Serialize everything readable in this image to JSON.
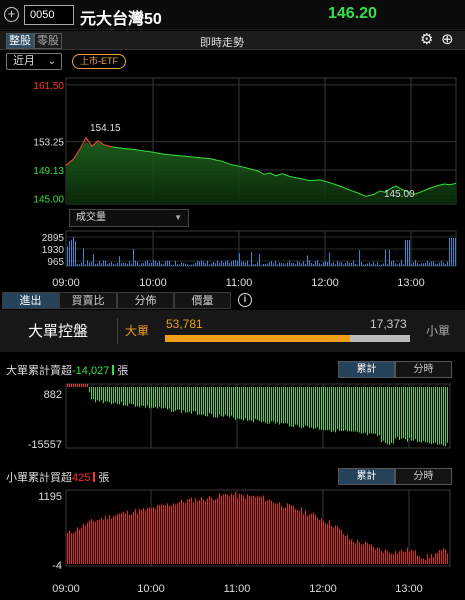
{
  "header": {
    "stock_code": "0050",
    "stock_name": "元大台灣50",
    "price": "146.20"
  },
  "toolbar": {
    "tab_whole": "整股",
    "tab_odd": "零股",
    "title": "即時走勢",
    "range_select": "近月",
    "badge": "上市-ETF"
  },
  "price_chart": {
    "y_ticks": [
      {
        "label": "161.50",
        "value": 161.5,
        "color": "#ff3030"
      },
      {
        "label": "153.25",
        "value": 153.25,
        "color": "#dddddd"
      },
      {
        "label": "149.13",
        "value": 149.13,
        "color": "#33e04a"
      },
      {
        "label": "145.00",
        "value": 145.0,
        "color": "#33e04a"
      }
    ],
    "annotation_high": "154.15",
    "annotation_low": "145.00",
    "reference_price": 153.25
  },
  "volume_chart": {
    "indicator": "成交量",
    "y_ticks": [
      "2895",
      "1930",
      "965"
    ]
  },
  "time_axis": [
    "09:00",
    "10:00",
    "11:00",
    "12:00",
    "13:00"
  ],
  "bottom_tabs": [
    "進出",
    "買賣比",
    "分佈",
    "價量"
  ],
  "control": {
    "title": "大單控盤",
    "big_label": "大單",
    "big_value": "53,781",
    "small_value": "17,373",
    "small_label": "小單",
    "big_ratio": 0.756
  },
  "big_panel": {
    "label": "大單累計賣超",
    "value": "-14,027",
    "unit": "張",
    "tab_cumulative": "累計",
    "tab_timeshare": "分時",
    "y_ticks": [
      "882",
      "-15557"
    ]
  },
  "small_panel": {
    "label": "小單累計買超",
    "value": "425",
    "unit": "張",
    "tab_cumulative": "累計",
    "tab_timeshare": "分時",
    "y_ticks": [
      "1195",
      "-4"
    ]
  },
  "colors": {
    "up": "#ff3030",
    "down": "#33e04a",
    "accent": "#f0a020",
    "tab_active": "#27435b"
  }
}
